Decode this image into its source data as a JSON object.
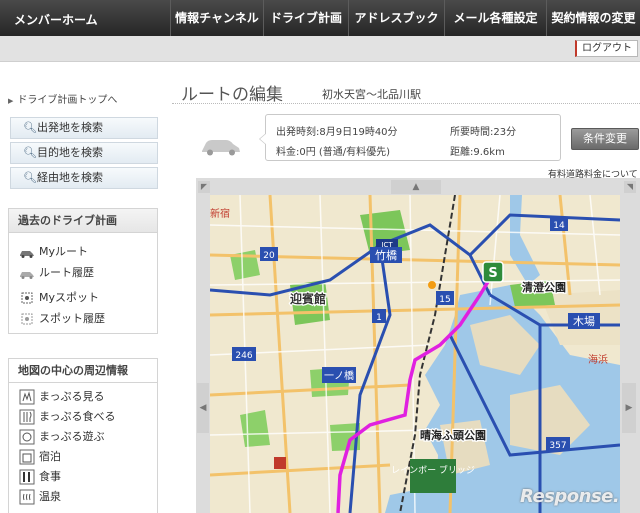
{
  "nav": {
    "brand": "メンバーホーム",
    "items": [
      "情報チャンネル",
      "ドライブ計画",
      "アドレスブック",
      "メール各種設定",
      "契約情報の変更"
    ],
    "logout": "ログアウト"
  },
  "sidebar": {
    "breadcrumb": "ドライブ計画トップへ",
    "search_buttons": [
      "出発地を検索",
      "目的地を検索",
      "経由地を検索"
    ],
    "past_plans": {
      "title": "過去のドライブ計画",
      "items": [
        "Myルート",
        "ルート履歴",
        "Myスポット",
        "スポット履歴"
      ]
    },
    "nearby": {
      "title": "地図の中心の周辺情報",
      "items": [
        "まっぷる見る",
        "まっぷる食べる",
        "まっぷる遊ぶ",
        "宿泊",
        "食事",
        "温泉"
      ]
    }
  },
  "main": {
    "title": "ルートの編集",
    "route_name": "初水天宮〜北品川駅",
    "departure": "出発時刻:8月9日19時40分",
    "duration": "所要時間:23分",
    "fee": "料金:0円 (普通/有料優先)",
    "distance": "距離:9.6km",
    "condition_button": "条件変更",
    "toll_link": "有料道路料金について"
  },
  "map": {
    "start_marker": "S",
    "route_color": "#e020e0",
    "labels": {
      "takebashi": "竹橋",
      "geihinkan": "迎賓館",
      "kiyosumi": "清澄公園",
      "kiba": "木場",
      "harumi": "晴海ふ頭公園",
      "rainbow": "レインボー ブリッジ",
      "ichinohashi": "一ノ橋",
      "shinjuku": "新宿",
      "jct": "JCT",
      "kaihin": "海浜"
    },
    "route_numbers": [
      "20",
      "246",
      "14",
      "15",
      "1",
      "357"
    ]
  },
  "watermark": "Response."
}
